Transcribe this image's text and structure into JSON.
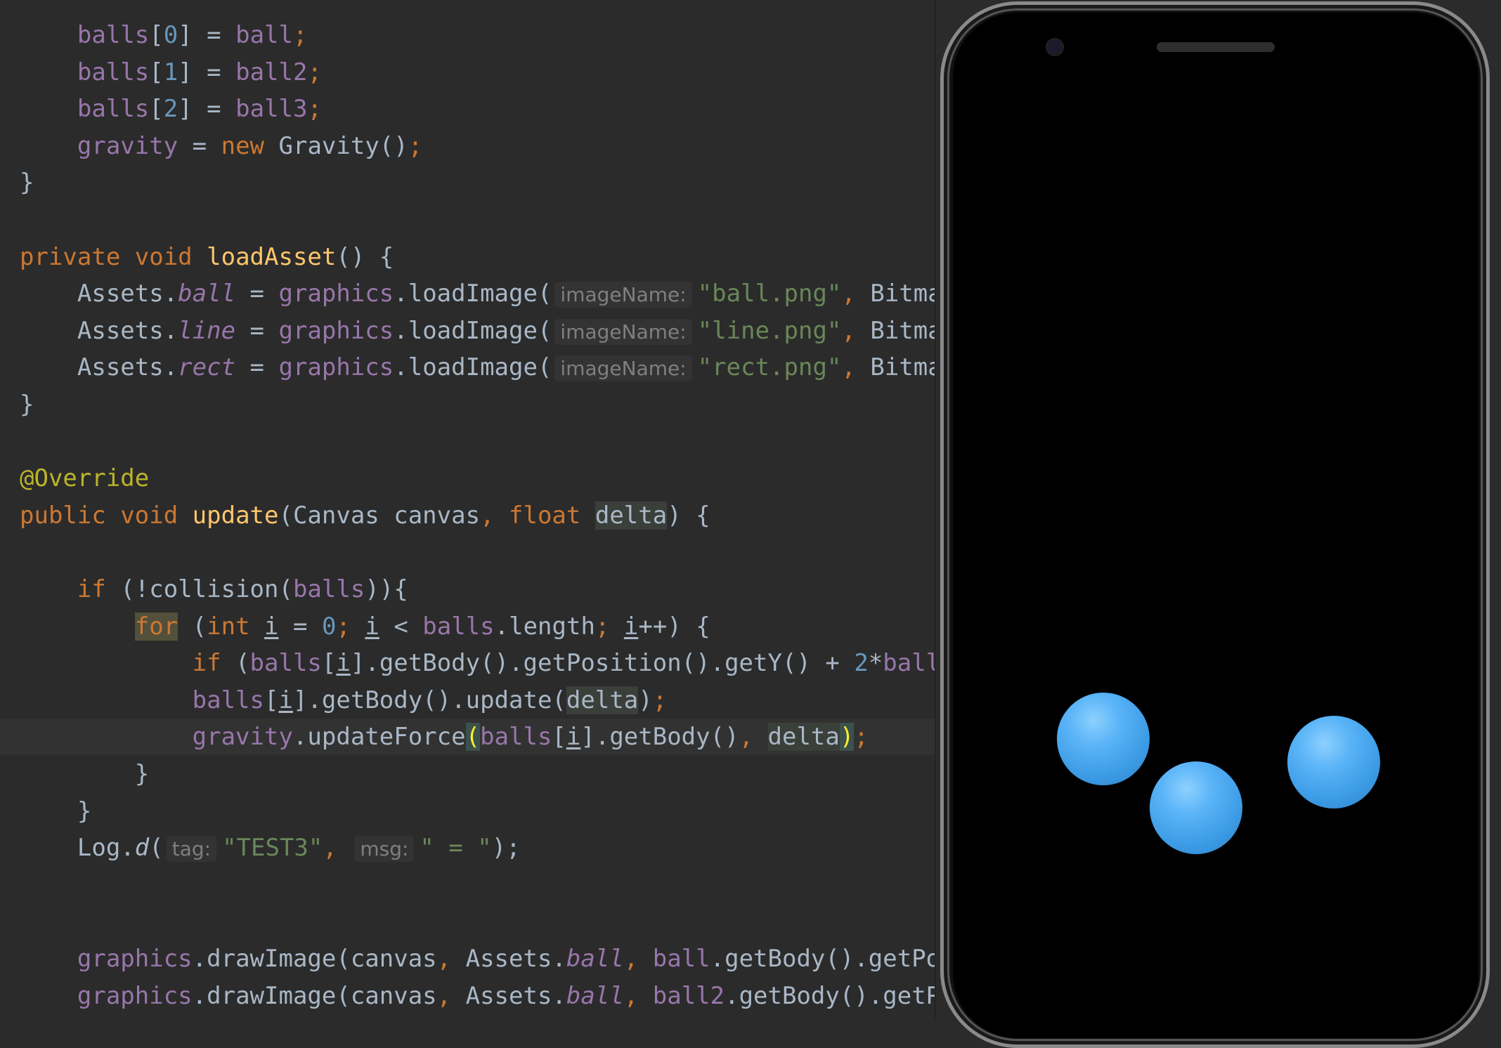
{
  "editor": {
    "lines": [
      {
        "tokens": [
          {
            "t": "    "
          },
          {
            "t": "balls",
            "c": "fld"
          },
          {
            "t": "["
          },
          {
            "t": "0",
            "c": "num"
          },
          {
            "t": "] = "
          },
          {
            "t": "ball",
            "c": "fld"
          },
          {
            "t": ";",
            "c": "kw"
          }
        ]
      },
      {
        "tokens": [
          {
            "t": "    "
          },
          {
            "t": "balls",
            "c": "fld"
          },
          {
            "t": "["
          },
          {
            "t": "1",
            "c": "num"
          },
          {
            "t": "] = "
          },
          {
            "t": "ball2",
            "c": "fld"
          },
          {
            "t": ";",
            "c": "kw"
          }
        ]
      },
      {
        "tokens": [
          {
            "t": "    "
          },
          {
            "t": "balls",
            "c": "fld"
          },
          {
            "t": "["
          },
          {
            "t": "2",
            "c": "num"
          },
          {
            "t": "] = "
          },
          {
            "t": "ball3",
            "c": "fld"
          },
          {
            "t": ";",
            "c": "kw"
          }
        ]
      },
      {
        "tokens": [
          {
            "t": "    "
          },
          {
            "t": "gravity",
            "c": "fld"
          },
          {
            "t": " = "
          },
          {
            "t": "new ",
            "c": "kw"
          },
          {
            "t": "Gravity()"
          },
          {
            "t": ";",
            "c": "kw"
          }
        ]
      },
      {
        "tokens": [
          {
            "t": "}"
          }
        ]
      },
      {
        "tokens": []
      },
      {
        "tokens": [
          {
            "t": "private ",
            "c": "kw"
          },
          {
            "t": "void ",
            "c": "kw"
          },
          {
            "t": "loadAsset",
            "c": "fn"
          },
          {
            "t": "() {"
          }
        ]
      },
      {
        "tokens": [
          {
            "t": "    Assets."
          },
          {
            "t": "ball",
            "c": "fld it"
          },
          {
            "t": " = "
          },
          {
            "t": "graphics",
            "c": "fld"
          },
          {
            "t": ".loadImage("
          },
          {
            "t": "imageName:",
            "c": "hint"
          },
          {
            "t": "\"ball.png\"",
            "c": "str"
          },
          {
            "t": ", ",
            "c": "kw"
          },
          {
            "t": "Bitmap"
          }
        ]
      },
      {
        "tokens": [
          {
            "t": "    Assets."
          },
          {
            "t": "line",
            "c": "fld it"
          },
          {
            "t": " = "
          },
          {
            "t": "graphics",
            "c": "fld"
          },
          {
            "t": ".loadImage("
          },
          {
            "t": "imageName:",
            "c": "hint"
          },
          {
            "t": "\"line.png\"",
            "c": "str"
          },
          {
            "t": ", ",
            "c": "kw"
          },
          {
            "t": "Bitmap"
          }
        ]
      },
      {
        "tokens": [
          {
            "t": "    Assets."
          },
          {
            "t": "rect",
            "c": "fld it"
          },
          {
            "t": " = "
          },
          {
            "t": "graphics",
            "c": "fld"
          },
          {
            "t": ".loadImage("
          },
          {
            "t": "imageName:",
            "c": "hint"
          },
          {
            "t": "\"rect.png\"",
            "c": "str"
          },
          {
            "t": ", ",
            "c": "kw"
          },
          {
            "t": "Bitmap"
          }
        ]
      },
      {
        "tokens": [
          {
            "t": "}"
          }
        ]
      },
      {
        "tokens": []
      },
      {
        "tokens": [
          {
            "t": "@Override",
            "c": "ann"
          }
        ]
      },
      {
        "tokens": [
          {
            "t": "public ",
            "c": "kw"
          },
          {
            "t": "void ",
            "c": "kw"
          },
          {
            "t": "update",
            "c": "fn"
          },
          {
            "t": "(Canvas canvas"
          },
          {
            "t": ", ",
            "c": "kw"
          },
          {
            "t": "float ",
            "c": "kw"
          },
          {
            "t": "delta",
            "c": "param"
          },
          {
            "t": ") {"
          }
        ]
      },
      {
        "tokens": []
      },
      {
        "tokens": [
          {
            "t": "    "
          },
          {
            "t": "if ",
            "c": "kw"
          },
          {
            "t": "(!collision("
          },
          {
            "t": "balls",
            "c": "fld"
          },
          {
            "t": ")){"
          }
        ]
      },
      {
        "tokens": [
          {
            "t": "        "
          },
          {
            "t": "for",
            "c": "kwhl"
          },
          {
            "t": " ("
          },
          {
            "t": "int ",
            "c": "kw"
          },
          {
            "t": "i",
            "c": "u"
          },
          {
            "t": " = "
          },
          {
            "t": "0",
            "c": "num"
          },
          {
            "t": "; ",
            "c": "kw"
          },
          {
            "t": "i",
            "c": "u"
          },
          {
            "t": " < "
          },
          {
            "t": "balls",
            "c": "fld"
          },
          {
            "t": ".length"
          },
          {
            "t": "; ",
            "c": "kw"
          },
          {
            "t": "i",
            "c": "u"
          },
          {
            "t": "++) {"
          }
        ]
      },
      {
        "tokens": [
          {
            "t": "            "
          },
          {
            "t": "if ",
            "c": "kw"
          },
          {
            "t": "("
          },
          {
            "t": "balls",
            "c": "fld"
          },
          {
            "t": "["
          },
          {
            "t": "i",
            "c": "u"
          },
          {
            "t": "].getBody().getPosition().getY() + "
          },
          {
            "t": "2",
            "c": "num"
          },
          {
            "t": "*"
          },
          {
            "t": "balls",
            "c": "fld"
          }
        ]
      },
      {
        "tokens": [
          {
            "t": "            "
          },
          {
            "t": "balls",
            "c": "fld"
          },
          {
            "t": "["
          },
          {
            "t": "i",
            "c": "u"
          },
          {
            "t": "].getBody().update("
          },
          {
            "t": "delta",
            "c": "param"
          },
          {
            "t": ")"
          },
          {
            "t": ";",
            "c": "kw"
          }
        ]
      },
      {
        "current": true,
        "tokens": [
          {
            "t": "            "
          },
          {
            "t": "gravity",
            "c": "fld"
          },
          {
            "t": ".updateForce"
          },
          {
            "t": "(",
            "c": "brmatch"
          },
          {
            "t": "balls",
            "c": "fld"
          },
          {
            "t": "["
          },
          {
            "t": "i",
            "c": "u"
          },
          {
            "t": "].getBody()"
          },
          {
            "t": ", ",
            "c": "kw"
          },
          {
            "t": "delta",
            "c": "param"
          },
          {
            "t": ")",
            "c": "brmatch"
          },
          {
            "t": ";",
            "c": "kw"
          }
        ]
      },
      {
        "tokens": [
          {
            "t": "        }"
          }
        ]
      },
      {
        "tokens": [
          {
            "t": "    }"
          }
        ]
      },
      {
        "tokens": [
          {
            "t": "    Log."
          },
          {
            "t": "d",
            "c": "it"
          },
          {
            "t": "("
          },
          {
            "t": "tag:",
            "c": "hint"
          },
          {
            "t": "\"TEST3\"",
            "c": "str"
          },
          {
            "t": ", ",
            "c": "kw"
          },
          {
            "t": "msg:",
            "c": "hint"
          },
          {
            "t": "\" = \"",
            "c": "str"
          },
          {
            "t": ");"
          }
        ]
      },
      {
        "tokens": []
      },
      {
        "tokens": []
      },
      {
        "tokens": [
          {
            "t": "    "
          },
          {
            "t": "graphics",
            "c": "fld"
          },
          {
            "t": ".drawImage(canvas"
          },
          {
            "t": ", ",
            "c": "kw"
          },
          {
            "t": "Assets."
          },
          {
            "t": "ball",
            "c": "fld it"
          },
          {
            "t": ", ",
            "c": "kw"
          },
          {
            "t": "ball",
            "c": "fld"
          },
          {
            "t": ".getBody().getPos"
          }
        ]
      },
      {
        "tokens": [
          {
            "t": "    "
          },
          {
            "t": "graphics",
            "c": "fld"
          },
          {
            "t": ".drawImage(canvas"
          },
          {
            "t": ", ",
            "c": "kw"
          },
          {
            "t": "Assets."
          },
          {
            "t": "ball",
            "c": "fld it"
          },
          {
            "t": ", ",
            "c": "kw"
          },
          {
            "t": "ball2",
            "c": "fld"
          },
          {
            "t": ".getBody().getPo"
          }
        ]
      }
    ]
  },
  "device": {
    "balls": [
      {
        "label": "ball-1"
      },
      {
        "label": "ball-2"
      },
      {
        "label": "ball-3"
      }
    ],
    "ball_color": "#4ba8ef"
  }
}
